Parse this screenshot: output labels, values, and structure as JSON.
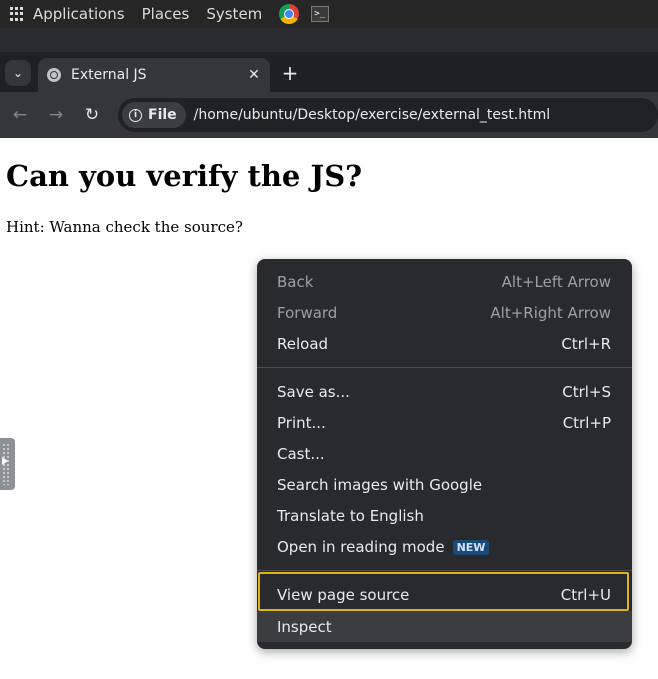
{
  "system_panel": {
    "menus": [
      "Applications",
      "Places",
      "System"
    ]
  },
  "browser": {
    "tab": {
      "title": "External JS",
      "close": "✕"
    },
    "new_tab": "+",
    "tab_search": "⌄",
    "nav": {
      "back": "←",
      "forward": "→",
      "reload": "↻"
    },
    "address": {
      "chip_label": "File",
      "info": "i",
      "url": "/home/ubuntu/Desktop/exercise/external_test.html"
    }
  },
  "page": {
    "heading": "Can you verify the JS?",
    "hint": "Hint: Wanna check the source?"
  },
  "context_menu": {
    "items": [
      {
        "label": "Back",
        "shortcut": "Alt+Left Arrow"
      },
      {
        "label": "Forward",
        "shortcut": "Alt+Right Arrow"
      },
      {
        "label": "Reload",
        "shortcut": "Ctrl+R"
      },
      {
        "label": "Save as...",
        "shortcut": "Ctrl+S"
      },
      {
        "label": "Print...",
        "shortcut": "Ctrl+P"
      },
      {
        "label": "Cast...",
        "shortcut": ""
      },
      {
        "label": "Search images with Google",
        "shortcut": ""
      },
      {
        "label": "Translate to English",
        "shortcut": ""
      },
      {
        "label": "Open in reading mode",
        "shortcut": "",
        "badge": "NEW"
      },
      {
        "label": "View page source",
        "shortcut": "Ctrl+U"
      },
      {
        "label": "Inspect",
        "shortcut": ""
      }
    ],
    "highlight_color": "#dbb514"
  }
}
